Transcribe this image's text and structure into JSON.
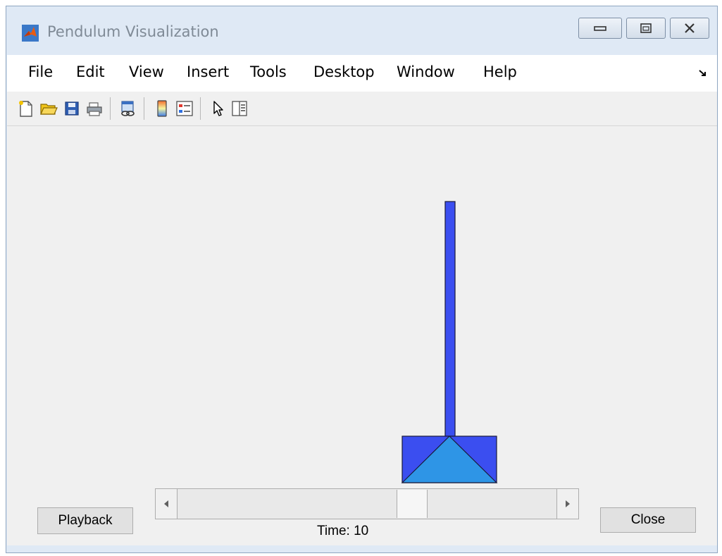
{
  "window": {
    "title": "Pendulum Visualization",
    "icon": "matlab-icon",
    "controls": [
      "minimize-icon",
      "maximize-icon",
      "close-icon"
    ]
  },
  "menubar": {
    "items": [
      {
        "label": "File"
      },
      {
        "label": "Edit"
      },
      {
        "label": "View"
      },
      {
        "label": "Insert"
      },
      {
        "label": "Tools"
      },
      {
        "label": "Desktop"
      },
      {
        "label": "Window"
      },
      {
        "label": "Help"
      }
    ],
    "dock_icon": "dock-arrow-icon"
  },
  "toolbar": {
    "buttons": [
      "new-figure-icon",
      "open-file-icon",
      "save-icon",
      "print-icon",
      "link-plot-icon",
      "insert-colorbar-icon",
      "insert-legend-icon",
      "edit-plot-icon",
      "property-inspector-icon"
    ]
  },
  "controls": {
    "playback_label": "Playback",
    "close_label": "Close",
    "time_label": "Time: 10",
    "slider_position": 0.63
  },
  "colors": {
    "pendulum_rod": "#3b4ef0",
    "cart_body": "#3b4ef0",
    "cart_triangle": "#2e95e6",
    "figure_background": "#f0f0f0"
  }
}
